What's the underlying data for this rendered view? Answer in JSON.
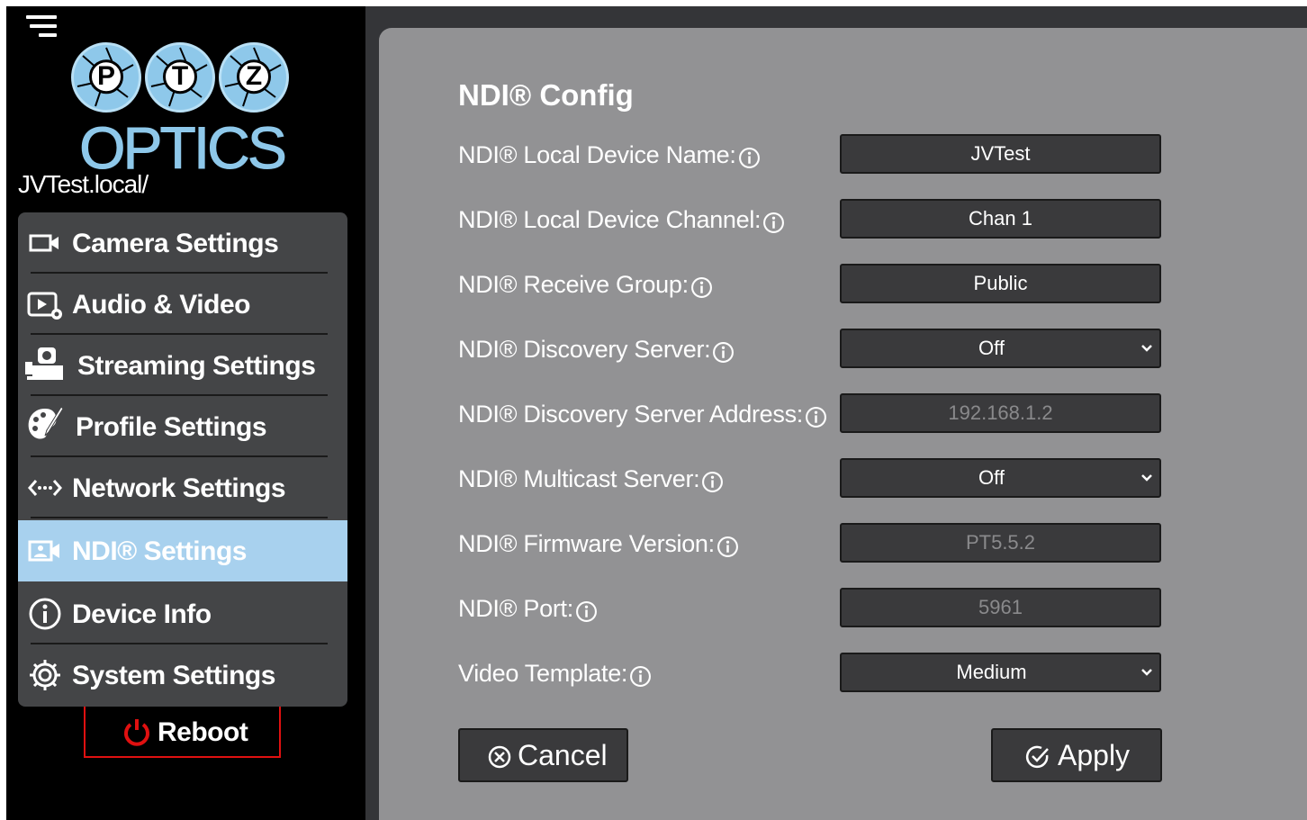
{
  "sidebar": {
    "hostname": "JVTest.local/",
    "logo": {
      "letters": [
        "P",
        "T",
        "Z"
      ],
      "word": "OPTICS"
    },
    "items": [
      {
        "label": "Camera Settings",
        "icon": "camera-icon"
      },
      {
        "label": "Audio & Video",
        "icon": "audio-video-icon"
      },
      {
        "label": "Streaming Settings",
        "icon": "streaming-icon"
      },
      {
        "label": "Profile Settings",
        "icon": "profile-palette-icon"
      },
      {
        "label": "Network Settings",
        "icon": "network-icon"
      },
      {
        "label": "NDI® Settings",
        "icon": "ndi-icon",
        "active": true
      },
      {
        "label": "Device Info",
        "icon": "info-icon"
      },
      {
        "label": "System Settings",
        "icon": "gear-icon"
      }
    ],
    "reboot_label": "Reboot"
  },
  "main": {
    "title": "NDI® Config",
    "fields": [
      {
        "label": "NDI® Local Device Name:",
        "value": "JVTest",
        "type": "input"
      },
      {
        "label": "NDI® Local Device Channel:",
        "value": "Chan 1",
        "type": "input"
      },
      {
        "label": "NDI® Receive Group:",
        "value": "Public",
        "type": "input"
      },
      {
        "label": "NDI® Discovery Server:",
        "value": "Off",
        "type": "select"
      },
      {
        "label": "NDI® Discovery Server Address:",
        "value": "192.168.1.2",
        "type": "input-disabled"
      },
      {
        "label": "NDI® Multicast Server:",
        "value": "Off",
        "type": "select"
      },
      {
        "label": "NDI® Firmware Version:",
        "value": "PT5.5.2",
        "type": "input-disabled"
      },
      {
        "label": "NDI® Port:",
        "value": "5961",
        "type": "input-disabled"
      },
      {
        "label": "Video Template:",
        "value": "Medium",
        "type": "select"
      }
    ],
    "cancel_label": "Cancel",
    "apply_label": "Apply"
  },
  "colors": {
    "sidebar_bg": "#000000",
    "menu_bg": "#444547",
    "active_item": "#a8d1ee",
    "panel_bg": "#929294",
    "field_bg": "#3a3a3c",
    "reboot_border": "#e01010",
    "logo_blue": "#8ec8ea"
  }
}
